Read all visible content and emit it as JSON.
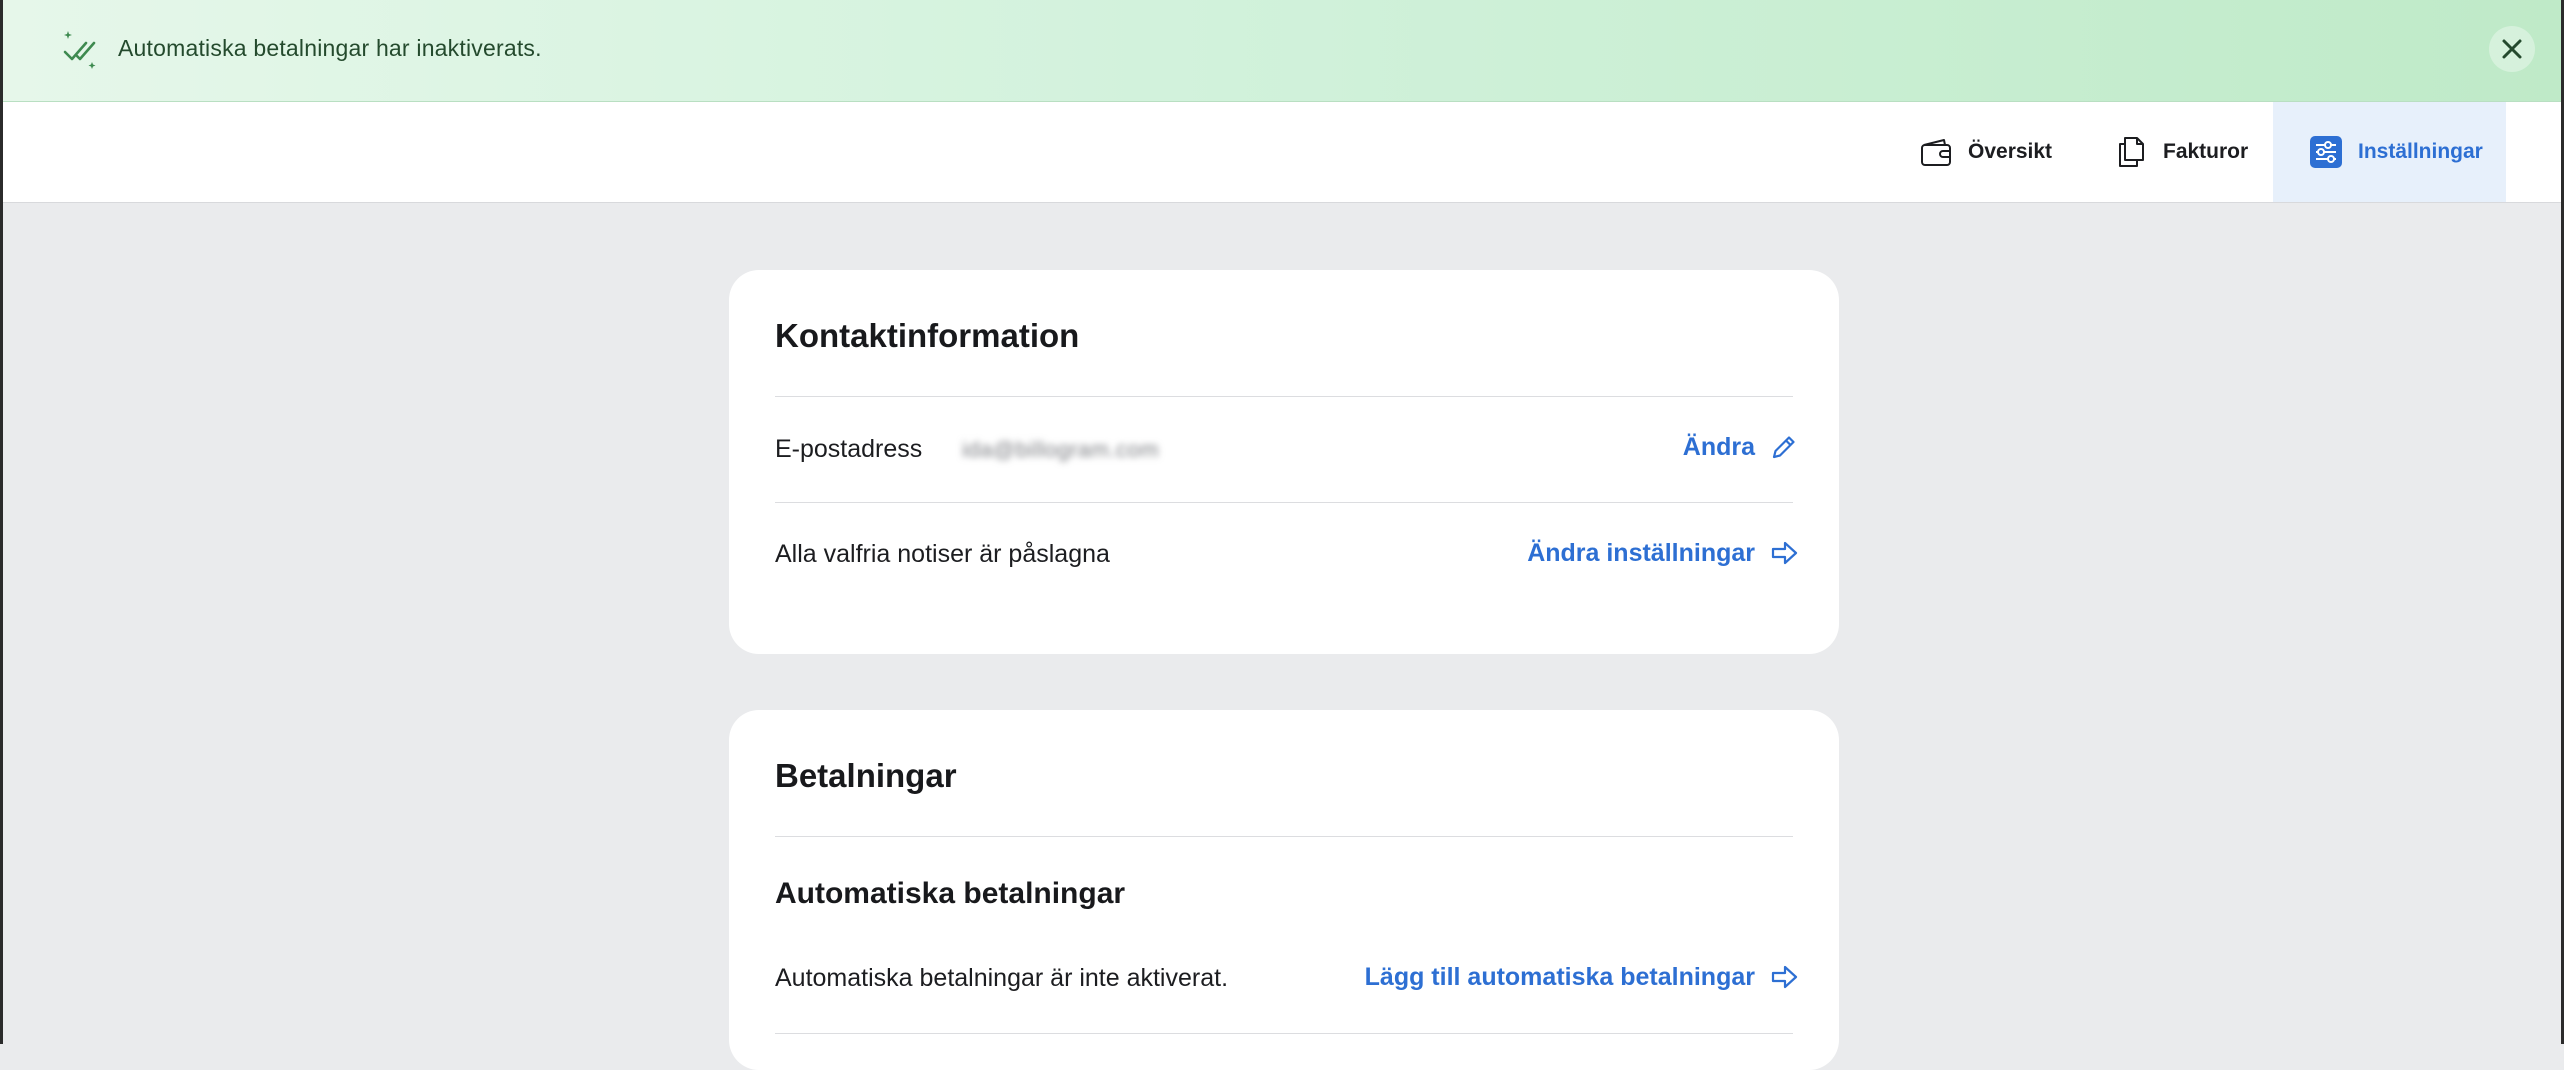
{
  "banner": {
    "message": "Automatiska betalningar har inaktiverats.",
    "icon": "double-check-sparkle-icon",
    "close_icon": "close-icon"
  },
  "nav": {
    "items": [
      {
        "label": "Översikt",
        "icon": "wallet-icon",
        "active": false
      },
      {
        "label": "Fakturor",
        "icon": "documents-icon",
        "active": false
      },
      {
        "label": "Inställningar",
        "icon": "sliders-icon",
        "active": true
      }
    ]
  },
  "contact": {
    "title": "Kontaktinformation",
    "email_label": "E-postadress",
    "email_value": "ida@billogram.com",
    "email_action": "Ändra",
    "notifications_text": "Alla valfria notiser är påslagna",
    "notifications_action": "Ändra inställningar"
  },
  "payments": {
    "title": "Betalningar",
    "autopay_heading": "Automatiska betalningar",
    "autopay_status": "Automatiska betalningar är inte aktiverat.",
    "autopay_action": "Lägg till automatiska betalningar"
  },
  "colors": {
    "accent": "#2d6fd3",
    "success_bg": "#d2f2dc",
    "success_text": "#244a2d",
    "page_bg": "#eaebed"
  }
}
